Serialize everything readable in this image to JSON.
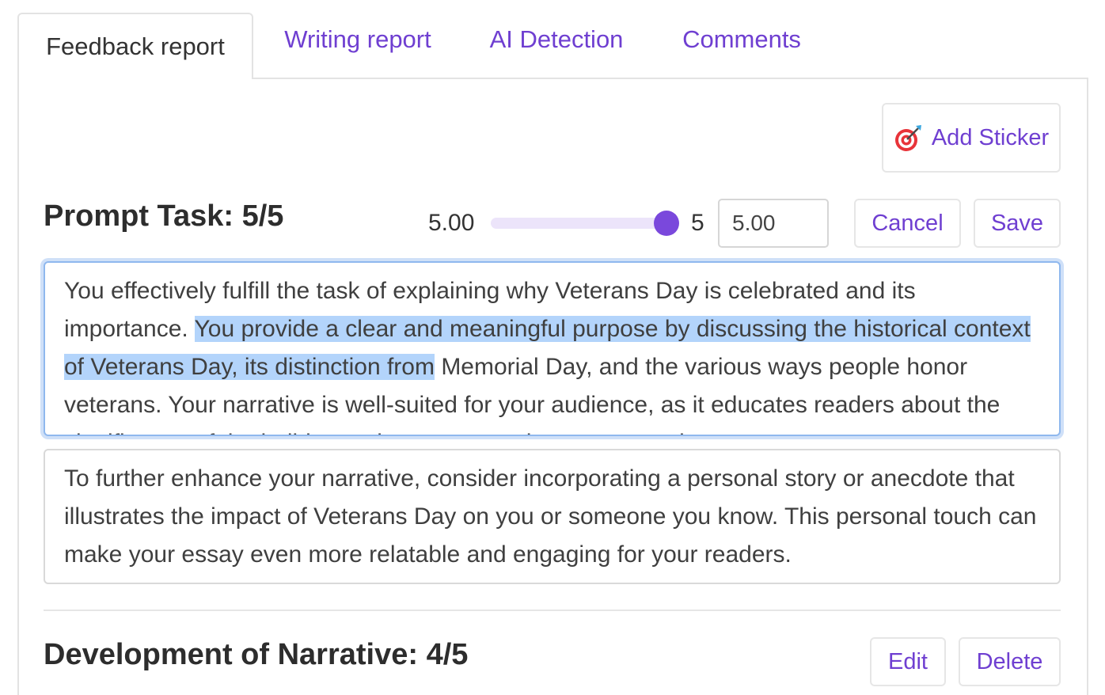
{
  "tabs": [
    {
      "label": "Feedback report",
      "active": true
    },
    {
      "label": "Writing report",
      "active": false
    },
    {
      "label": "AI Detection",
      "active": false
    },
    {
      "label": "Comments",
      "active": false
    }
  ],
  "sticker_button": {
    "label": "Add Sticker",
    "icon": "target-dart-icon"
  },
  "sections": [
    {
      "title": "Prompt Task: 5/5",
      "score_value_display": "5.00",
      "slider": {
        "min": 0,
        "max": 5,
        "value": 5
      },
      "slider_max_label": "5",
      "score_input_value": "5.00",
      "cancel_label": "Cancel",
      "save_label": "Save",
      "feedback_before": "You effectively fulfill the task of explaining why Veterans Day is celebrated and its importance. ",
      "feedback_selected": "You provide a clear and meaningful purpose by discussing the historical context of Veterans Day, its distinction from",
      "feedback_after": " Memorial Day, and the various ways people honor veterans. Your narrative is well-suited for your audience, as it educates readers about the significance of the holiday and encourages them to remember",
      "suggestion": "To further enhance your narrative, consider incorporating a personal story or anecdote that illustrates the impact of Veterans Day on you or someone you know. This personal touch can make your essay even more relatable and engaging for your readers."
    },
    {
      "title": "Development of Narrative: 4/5",
      "edit_label": "Edit",
      "delete_label": "Delete"
    }
  ],
  "colors": {
    "accent": "#6f3fd1",
    "slider_thumb": "#7a48dc",
    "slider_track": "#ece4fa",
    "selection_highlight": "#b3d4fb",
    "focus_border": "#8fb8ee"
  }
}
